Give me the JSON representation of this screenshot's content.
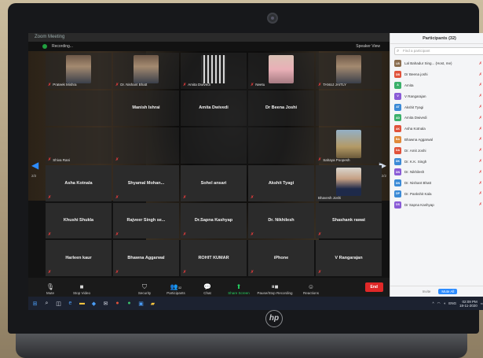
{
  "window": {
    "title": "Zoom Meeting",
    "recording": "Recording...",
    "view_mode": "Speaker View"
  },
  "tiles": [
    {
      "name": "",
      "label": "Prateek Mishra",
      "face": "face",
      "muted": true
    },
    {
      "name": "",
      "label": "Dr. Nishant Bhatt",
      "face": "face",
      "muted": true
    },
    {
      "name": "",
      "label": "Amita Dwivedi",
      "face": "shelf",
      "muted": true
    },
    {
      "name": "",
      "label": "Neetu",
      "face": "pink",
      "muted": true
    },
    {
      "name": "",
      "label": "TANUJ JAITLY",
      "face": "face",
      "muted": true
    },
    {
      "name": "",
      "label": "",
      "face": "",
      "muted": false
    },
    {
      "name": "Manish Ishrai",
      "label": "",
      "face": "",
      "muted": false
    },
    {
      "name": "Amita Dwivedi",
      "label": "",
      "face": "",
      "muted": false
    },
    {
      "name": "Dr Beena Joshi",
      "label": "",
      "face": "",
      "muted": false
    },
    {
      "name": "",
      "label": "",
      "face": "",
      "muted": false
    },
    {
      "name": "",
      "label": "Shiva Rani",
      "face": "",
      "muted": true
    },
    {
      "name": "",
      "label": "",
      "face": "",
      "muted": true
    },
    {
      "name": "",
      "label": "",
      "face": "",
      "muted": false
    },
    {
      "name": "",
      "label": "",
      "face": "",
      "muted": false
    },
    {
      "name": "",
      "label": "Sahaya Poopesh",
      "face": "outdoor",
      "muted": true
    },
    {
      "name": "Asha Kotnala",
      "label": "",
      "face": "",
      "muted": true
    },
    {
      "name": "Shyamal Mohan...",
      "label": "",
      "face": "",
      "muted": true
    },
    {
      "name": "Sohel ansari",
      "label": "",
      "face": "",
      "muted": true
    },
    {
      "name": "Akshit Tyagi",
      "label": "",
      "face": "",
      "muted": true
    },
    {
      "name": "",
      "label": "Bhavesh Joshi",
      "face": "suit",
      "muted": false
    },
    {
      "name": "Khushi Shukla",
      "label": "",
      "face": "",
      "muted": true
    },
    {
      "name": "Rajveer Singh se...",
      "label": "",
      "face": "",
      "muted": true
    },
    {
      "name": "Dr.Sapna Kashyap",
      "label": "",
      "face": "",
      "muted": true
    },
    {
      "name": "Dr. Nikhilesh",
      "label": "",
      "face": "",
      "muted": true
    },
    {
      "name": "Shashank rawat",
      "label": "",
      "face": "",
      "muted": true
    },
    {
      "name": "Harleen kaur",
      "label": "",
      "face": "",
      "muted": true
    },
    {
      "name": "Bhawna Aggarwal",
      "label": "",
      "face": "",
      "muted": true
    },
    {
      "name": "ROHIT KUMAR",
      "label": "",
      "face": "",
      "muted": true
    },
    {
      "name": "iPhone",
      "label": "",
      "face": "",
      "muted": true
    },
    {
      "name": "V Rangarajan",
      "label": "",
      "face": "",
      "muted": true
    }
  ],
  "pager": {
    "left": "2/2",
    "right": "2/2"
  },
  "toolbar": {
    "mute": "Mute",
    "stop_video": "Stop Video",
    "security": "Security",
    "participants": "Participants",
    "participants_count": "32",
    "chat": "Chat",
    "share_screen": "Share Screen",
    "record": "Pause/Stop Recording",
    "reactions": "Reactions",
    "end": "End"
  },
  "panel": {
    "title": "Participants (32)",
    "search_placeholder": "Find a participant",
    "mute_all": "Mute All",
    "invite": "Invite",
    "participants": [
      {
        "initials": "LB",
        "name": "Lal Bahadur Sing... (Host, me)",
        "color": "#8a6d4f"
      },
      {
        "initials": "DB",
        "name": "Dr Beena joshi",
        "color": "#e0523b"
      },
      {
        "initials": "A",
        "name": "Amita",
        "color": "#3bb06a"
      },
      {
        "initials": "V",
        "name": "V Rangarajan",
        "color": "#8a5bd6"
      },
      {
        "initials": "AT",
        "name": "Akshit Tyagi",
        "color": "#3b8ad6"
      },
      {
        "initials": "AD",
        "name": "Amita Dwivedi",
        "color": "#3bb06a"
      },
      {
        "initials": "AK",
        "name": "Asha Kotnala",
        "color": "#e0523b"
      },
      {
        "initials": "BA",
        "name": "Bhawna Aggarwal",
        "color": "#e08a3b"
      },
      {
        "initials": "DA",
        "name": "Dr. Amit Joshi",
        "color": "#e0523b"
      },
      {
        "initials": "DK",
        "name": "Dr. K.K. Singh",
        "color": "#3b8ad6"
      },
      {
        "initials": "DN",
        "name": "Dr. Nikhilesh",
        "color": "#8a5bd6"
      },
      {
        "initials": "DN",
        "name": "Dr. Nishant Bhatt",
        "color": "#3b8ad6"
      },
      {
        "initials": "DP",
        "name": "Dr. Pankshit Kala",
        "color": "#3b8ad6"
      },
      {
        "initials": "DS",
        "name": "Dr Sapna Kashyap",
        "color": "#8a5bd6"
      }
    ]
  },
  "taskbar": {
    "time": "02:09 PM",
    "date": "18-11-2020",
    "lang": "ENG"
  }
}
